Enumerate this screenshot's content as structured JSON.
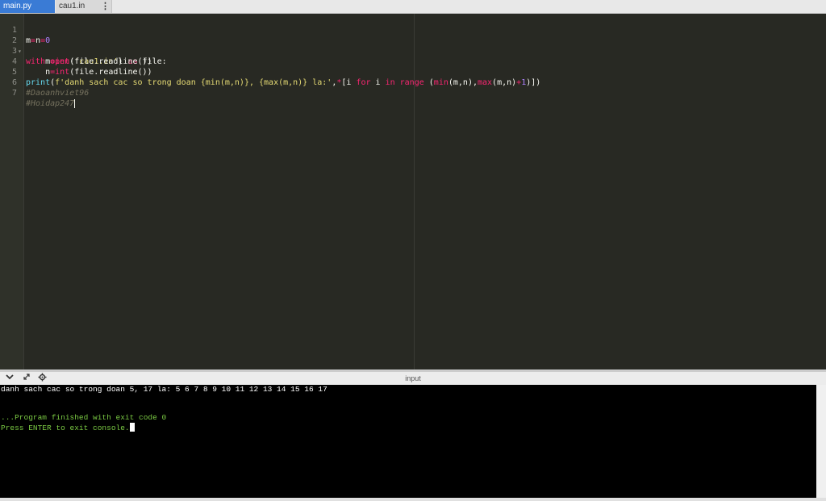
{
  "tabs": [
    {
      "label": "main.py",
      "active": true
    },
    {
      "label": "cau1.in",
      "active": false
    }
  ],
  "tab_menu_icon": "vertical-ellipsis-icon",
  "editor": {
    "lines": [
      {
        "number": "1"
      },
      {
        "number": "2",
        "fold": "▾"
      },
      {
        "number": "3"
      },
      {
        "number": "4"
      },
      {
        "number": "5"
      },
      {
        "number": "6"
      },
      {
        "number": "7"
      }
    ],
    "code": {
      "l1": {
        "a": "m",
        "b": "=",
        "c": "n",
        "d": "=",
        "e": "0"
      },
      "l2": {
        "a": "with ",
        "b": "open",
        "c": "(",
        "d": "'cau1.in'",
        "e": ") ",
        "f": "as",
        "g": " file:"
      },
      "l3": {
        "a": "    m",
        "b": "=",
        "c": "int",
        "d": "(file.readline())"
      },
      "l4": {
        "a": "    n",
        "b": "=",
        "c": "int",
        "d": "(file.readline())"
      },
      "l5": {
        "a": "print",
        "b": "(",
        "c": "f'danh sach cac so trong doan {min(m,n)}, {max(m,n)} la:'",
        "d": ",",
        "e": "*",
        "f": "[i ",
        "g": "for",
        "h": " i ",
        "i": "in",
        "j": " ",
        "k": "range",
        "l": " (",
        "m": "min",
        "n": "(m,n),",
        "o": "max",
        "p": "(m,n)",
        "q": "+",
        "r": "1",
        "s": ")])"
      },
      "l6": "#Daoanhviet96",
      "l7": "#Hoidap247"
    }
  },
  "console_bar": {
    "title": "input",
    "icons": [
      "chevron-down-icon",
      "expand-icon",
      "settings-icon"
    ]
  },
  "console": {
    "output": "danh sach cac so trong doan 5, 17 la: 5 6 7 8 9 10 11 12 13 14 15 16 17",
    "finished": "...Program finished with exit code 0",
    "press_enter": "Press ENTER to exit console."
  },
  "colors": {
    "editor_bg": "#282923",
    "keyword": "#f92672",
    "builtin": "#66d9ef",
    "string": "#e6db74",
    "number": "#ae81ff",
    "comment": "#75715e",
    "console_green": "#7ac943",
    "active_tab": "#3a7bd5"
  }
}
